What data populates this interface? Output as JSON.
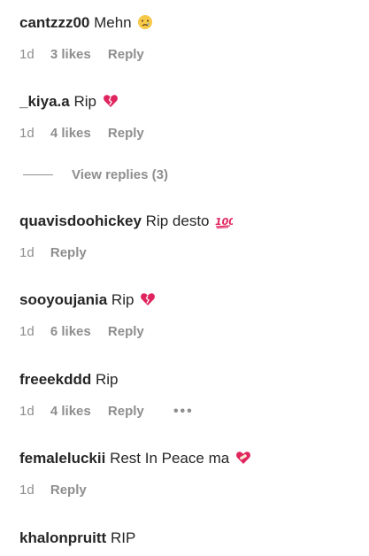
{
  "comments": [
    {
      "user": "cantzzz00",
      "text": "Mehn",
      "emoji": "sad-tear-emoji",
      "time": "1d",
      "likes": "3 likes",
      "reply": "Reply"
    },
    {
      "user": "_kiya.a",
      "text": "Rip",
      "emoji": "broken-heart-emoji",
      "time": "1d",
      "likes": "4 likes",
      "reply": "Reply"
    },
    {
      "user": "quavisdoohickey",
      "text": "Rip desto",
      "emoji": "hundred-points-emoji",
      "time": "1d",
      "reply": "Reply"
    },
    {
      "user": "sooyoujania",
      "text": "Rip",
      "emoji": "broken-heart-emoji",
      "time": "1d",
      "likes": "6 likes",
      "reply": "Reply"
    },
    {
      "user": "freeekddd",
      "text": "Rip",
      "time": "1d",
      "likes": "4 likes",
      "reply": "Reply",
      "more": "•••"
    },
    {
      "user": "femaleluckii",
      "text": "Rest In Peace ma",
      "emoji": "mending-heart-emoji",
      "time": "1d",
      "reply": "Reply"
    },
    {
      "user": "khalonpruitt",
      "text": "RIP"
    }
  ],
  "view_replies": "View replies (3)",
  "colors": {
    "primary_text": "#262626",
    "secondary_text": "#8e8e8e",
    "heart_red": "#e0245e"
  }
}
